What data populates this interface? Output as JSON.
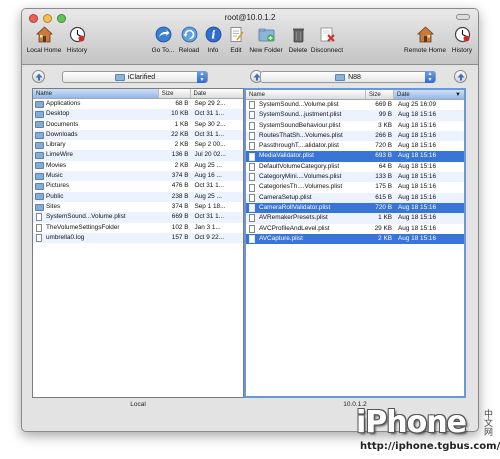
{
  "window": {
    "title": "root@10.0.1.2"
  },
  "toolbar": {
    "local_home": "Local Home",
    "history_left": "History",
    "goto": "Go To...",
    "reload": "Reload",
    "info": "Info",
    "edit": "Edit",
    "new_folder": "New Folder",
    "delete": "Delete",
    "disconnect": "Disconnect",
    "remote_home": "Remote Home",
    "history_right": "History"
  },
  "left": {
    "path": "iClarified",
    "columns": {
      "name": "Name",
      "size": "Size",
      "date": "Date"
    },
    "status": "Local",
    "rows": [
      {
        "name": "Applications",
        "size": "68 B",
        "date": "Sep 29 2...",
        "type": "folder",
        "selected": false
      },
      {
        "name": "Desktop",
        "size": "10 KB",
        "date": "Oct 31 1...",
        "type": "folder",
        "selected": false
      },
      {
        "name": "Documents",
        "size": "1 KB",
        "date": "Sep 30 2...",
        "type": "folder",
        "selected": false
      },
      {
        "name": "Downloads",
        "size": "22 KB",
        "date": "Oct 31 1...",
        "type": "folder",
        "selected": false
      },
      {
        "name": "Library",
        "size": "2 KB",
        "date": "Sep 2 00...",
        "type": "folder",
        "selected": false
      },
      {
        "name": "LimeWire",
        "size": "136 B",
        "date": "Jul 20 02...",
        "type": "folder",
        "selected": false
      },
      {
        "name": "Movies",
        "size": "2 KB",
        "date": "Aug 25 ...",
        "type": "folder",
        "selected": false
      },
      {
        "name": "Music",
        "size": "374 B",
        "date": "Aug 16 ...",
        "type": "folder",
        "selected": false
      },
      {
        "name": "Pictures",
        "size": "476 B",
        "date": "Oct 31 1...",
        "type": "folder",
        "selected": false
      },
      {
        "name": "Public",
        "size": "238 B",
        "date": "Aug 25 ...",
        "type": "folder",
        "selected": false
      },
      {
        "name": "Sites",
        "size": "374 B",
        "date": "Sep 1 18...",
        "type": "folder",
        "selected": false
      },
      {
        "name": "SystemSound...Volume.plist",
        "size": "669 B",
        "date": "Oct 31 1...",
        "type": "file",
        "selected": false
      },
      {
        "name": "TheVolumeSettingsFolder",
        "size": "102 B",
        "date": "Jan 3 1...",
        "type": "file",
        "selected": false
      },
      {
        "name": "umbrella0.log",
        "size": "157 B",
        "date": "Oct 9 22...",
        "type": "file",
        "selected": false
      }
    ]
  },
  "right": {
    "path": "N88",
    "columns": {
      "name": "Name",
      "size": "Size",
      "date": "Date"
    },
    "status": "10.0.1.2",
    "rows": [
      {
        "name": "SystemSound...Volume.plist",
        "size": "669 B",
        "date": "Aug 25 16:09",
        "type": "file",
        "selected": false
      },
      {
        "name": "SystemSound...justment.plist",
        "size": "99 B",
        "date": "Aug 18 15:16",
        "type": "file",
        "selected": false
      },
      {
        "name": "SystemSoundBehaviour.plist",
        "size": "3 KB",
        "date": "Aug 18 15:16",
        "type": "file",
        "selected": false
      },
      {
        "name": "RoutesThatSh...Volumes.plist",
        "size": "266 B",
        "date": "Aug 18 15:16",
        "type": "file",
        "selected": false
      },
      {
        "name": "PassthroughT....alidator.plist",
        "size": "720 B",
        "date": "Aug 18 15:16",
        "type": "file",
        "selected": false
      },
      {
        "name": "MediaValidator.plist",
        "size": "693 B",
        "date": "Aug 18 15:16",
        "type": "file",
        "selected": true
      },
      {
        "name": "DefaultVolumeCategory.plist",
        "size": "64 B",
        "date": "Aug 18 15:16",
        "type": "file",
        "selected": false
      },
      {
        "name": "CategoryMini....Volumes.plist",
        "size": "133 B",
        "date": "Aug 18 15:16",
        "type": "file",
        "selected": false
      },
      {
        "name": "CategoriesTh....Volumes.plist",
        "size": "175 B",
        "date": "Aug 18 15:16",
        "type": "file",
        "selected": false
      },
      {
        "name": "CameraSetup.plist",
        "size": "615 B",
        "date": "Aug 18 15:16",
        "type": "file",
        "selected": false
      },
      {
        "name": "CameraRollValidator.plist",
        "size": "720 B",
        "date": "Aug 18 15:16",
        "type": "file",
        "selected": true
      },
      {
        "name": "AVRemakerPresets.plist",
        "size": "1 KB",
        "date": "Aug 18 15:16",
        "type": "file",
        "selected": false
      },
      {
        "name": "AVCProfileAndLevel.plist",
        "size": "29 KB",
        "date": "Aug 18 15:16",
        "type": "file",
        "selected": false
      },
      {
        "name": "AVCapture.plist",
        "size": "2 KB",
        "date": "Aug 18 15:16",
        "type": "file",
        "selected": true
      }
    ]
  },
  "watermark": {
    "logo": "iPhone",
    "cn": "中文网",
    "url": "http://iphone.tgbus.com/"
  },
  "colors": {
    "selection": "#3875d7",
    "alt_row": "#edf3fe",
    "accent": "#6b97d6"
  }
}
